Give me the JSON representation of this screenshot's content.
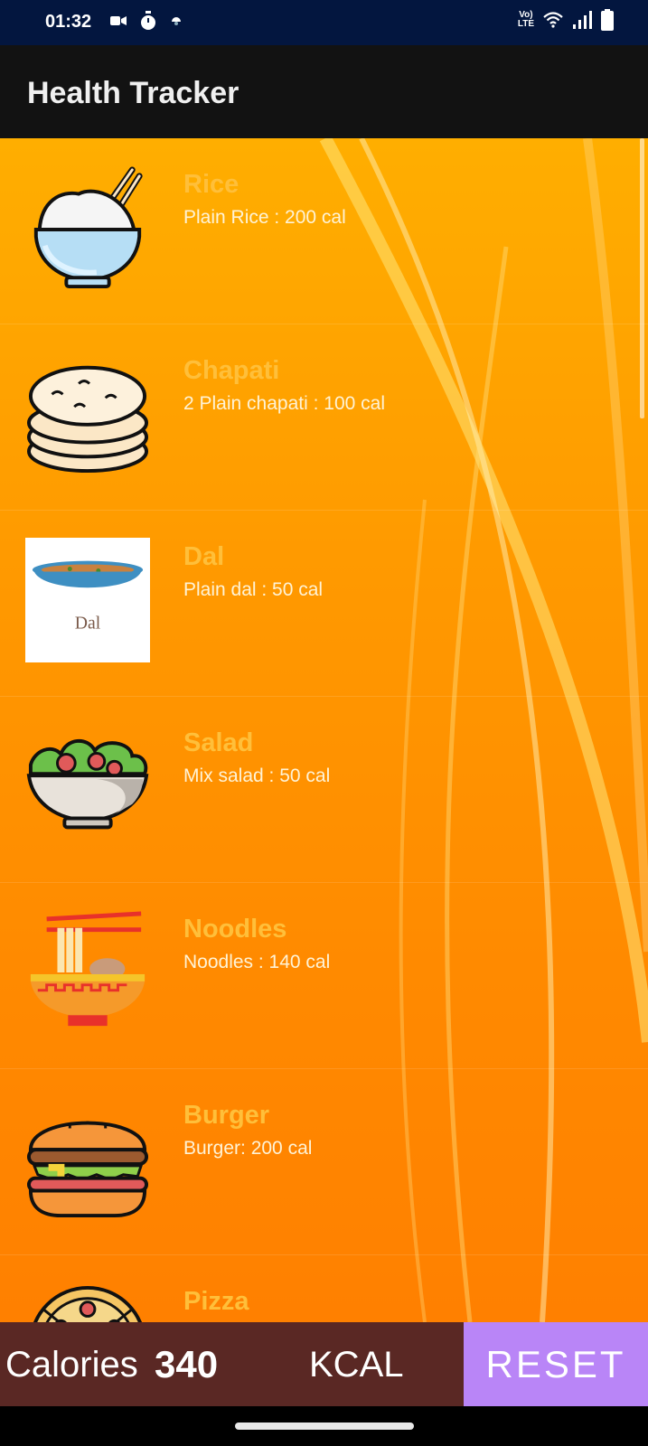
{
  "status_bar": {
    "time": "01:32",
    "left_icons": [
      "video-camera-icon",
      "timer-icon",
      "app-notification-icon"
    ],
    "right_icons": [
      "volte-icon",
      "wifi-icon",
      "signal-icon",
      "battery-icon"
    ],
    "volte_top": "Vo)",
    "volte_bottom": "LTE"
  },
  "app_bar": {
    "title": "Health Tracker"
  },
  "foods": [
    {
      "name": "Rice",
      "desc": "Plain Rice : 200 cal",
      "icon": "rice-bowl-icon"
    },
    {
      "name": "Chapati",
      "desc": " 2 Plain chapati : 100 cal",
      "icon": "chapati-icon"
    },
    {
      "name": "Dal",
      "desc": "Plain dal : 50 cal",
      "icon": "dal-bowl-icon",
      "icon_caption": "Dal"
    },
    {
      "name": "Salad",
      "desc": "Mix salad : 50 cal",
      "icon": "salad-bowl-icon"
    },
    {
      "name": "Noodles",
      "desc": "Noodles : 140 cal",
      "icon": "noodles-bowl-icon"
    },
    {
      "name": "Burger",
      "desc": "Burger: 200 cal",
      "icon": "burger-icon"
    },
    {
      "name": "Pizza",
      "desc": "",
      "icon": "pizza-icon"
    }
  ],
  "bottom_bar": {
    "calories_label": "Calories",
    "calories_value": "340",
    "unit_label": "KCAL",
    "reset_label": "RESET"
  },
  "colors": {
    "status_bar": "#03163f",
    "app_bar": "#121212",
    "list_background": "#ff9a00",
    "item_title": "#ffbf3a",
    "bottom_bar": "#5a2824",
    "reset_button": "#b985f7"
  }
}
